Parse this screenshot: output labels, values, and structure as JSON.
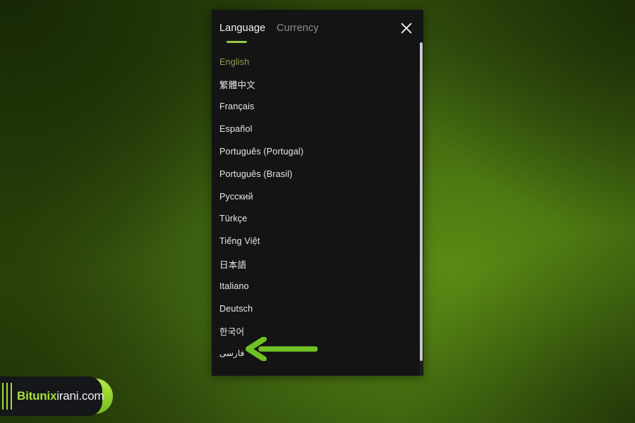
{
  "background": {
    "accent_green": "#4e7a12",
    "dark_green": "#2b4409"
  },
  "panel": {
    "background_color": "#141414",
    "tabs": [
      {
        "id": "language",
        "label": "Language",
        "active": true
      },
      {
        "id": "currency",
        "label": "Currency",
        "active": false
      }
    ],
    "close_icon": "close-icon",
    "active_tab_underline_color": "#95c93d",
    "scrollbar": {
      "visible": true,
      "thumb_color": "#c9c9c9"
    }
  },
  "language_list": {
    "selected_color": "#8d9e55",
    "items": [
      {
        "label": "English",
        "selected": true,
        "rtl": false
      },
      {
        "label": "繁體中文",
        "selected": false,
        "rtl": false
      },
      {
        "label": "Français",
        "selected": false,
        "rtl": false
      },
      {
        "label": "Español",
        "selected": false,
        "rtl": false
      },
      {
        "label": "Português (Portugal)",
        "selected": false,
        "rtl": false
      },
      {
        "label": "Português (Brasil)",
        "selected": false,
        "rtl": false
      },
      {
        "label": "Русский",
        "selected": false,
        "rtl": false
      },
      {
        "label": "Türkçe",
        "selected": false,
        "rtl": false
      },
      {
        "label": "Tiếng Việt",
        "selected": false,
        "rtl": false
      },
      {
        "label": "日本語",
        "selected": false,
        "rtl": false
      },
      {
        "label": "Italiano",
        "selected": false,
        "rtl": false
      },
      {
        "label": "Deutsch",
        "selected": false,
        "rtl": false
      },
      {
        "label": "한국어",
        "selected": false,
        "rtl": false
      },
      {
        "label": "فارسی",
        "selected": false,
        "rtl": true
      }
    ]
  },
  "annotation": {
    "arrow_icon": "left-arrow-icon",
    "arrow_color": "#6fc124",
    "points_to": "فارسی"
  },
  "watermark": {
    "brand": "Bitunix",
    "domain": "irani.com",
    "brand_color": "#a8e139",
    "domain_color": "#f0f0f0",
    "stripes": 3
  }
}
